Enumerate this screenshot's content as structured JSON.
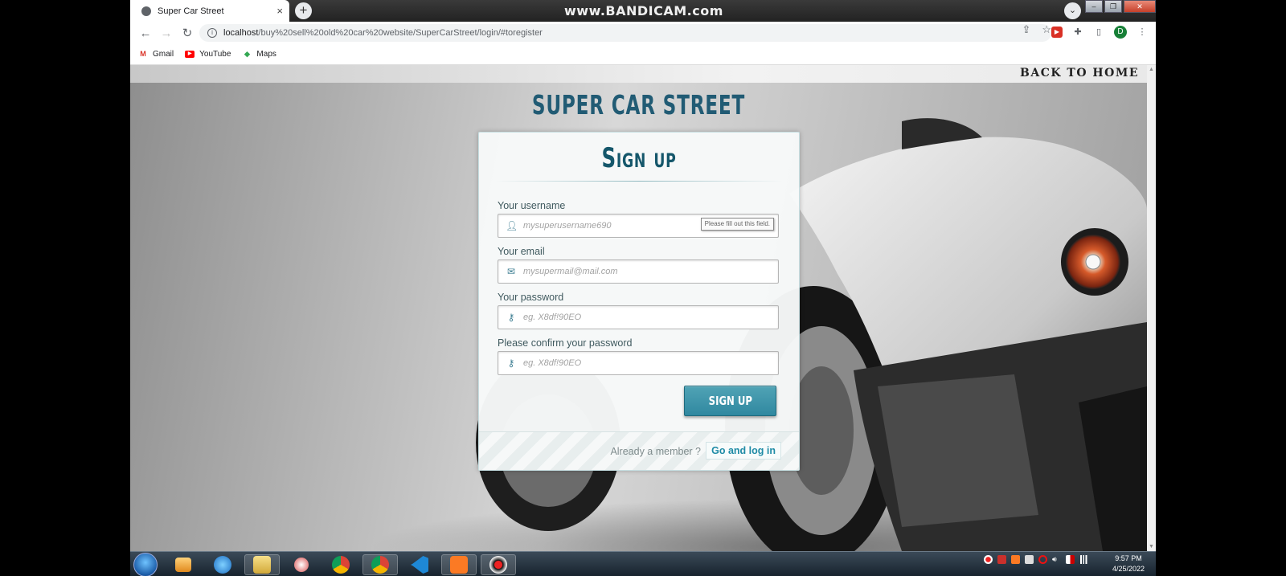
{
  "browser": {
    "watermark": "www.BANDICAM.com",
    "tab_title": "Super Car Street",
    "tab_close": "×",
    "new_tab": "+",
    "url_host": "localhost",
    "url_path": "/buy%20sell%20old%20car%20website/SuperCarStreet/login/#toregister",
    "profile_initial": "D",
    "bookmarks": [
      {
        "label": "Gmail",
        "icon": "gmail-icon"
      },
      {
        "label": "YouTube",
        "icon": "youtube-icon"
      },
      {
        "label": "Maps",
        "icon": "maps-icon"
      }
    ]
  },
  "page": {
    "back_home": "BACK TO HOME",
    "site_title": "SUPER CAR STREET",
    "form": {
      "heading": "Sign up",
      "username_label": "Your username",
      "username_placeholder": "mysuperusername690",
      "validation_tooltip": "Please fill out this field.",
      "email_label": "Your email",
      "email_placeholder": "mysupermail@mail.com",
      "password_label": "Your password",
      "password_placeholder": "eg. X8df!90EO",
      "confirm_label": "Please confirm your password",
      "confirm_placeholder": "eg. X8df!90EO",
      "submit_label": "SIGN UP",
      "already_member": "Already a member ?",
      "login_link": "Go and log in"
    }
  },
  "taskbar": {
    "time": "9:57 PM",
    "date": "4/25/2022"
  },
  "colors": {
    "brand": "#215b74",
    "button": "#3a93a9",
    "link": "#1f8ba6"
  }
}
